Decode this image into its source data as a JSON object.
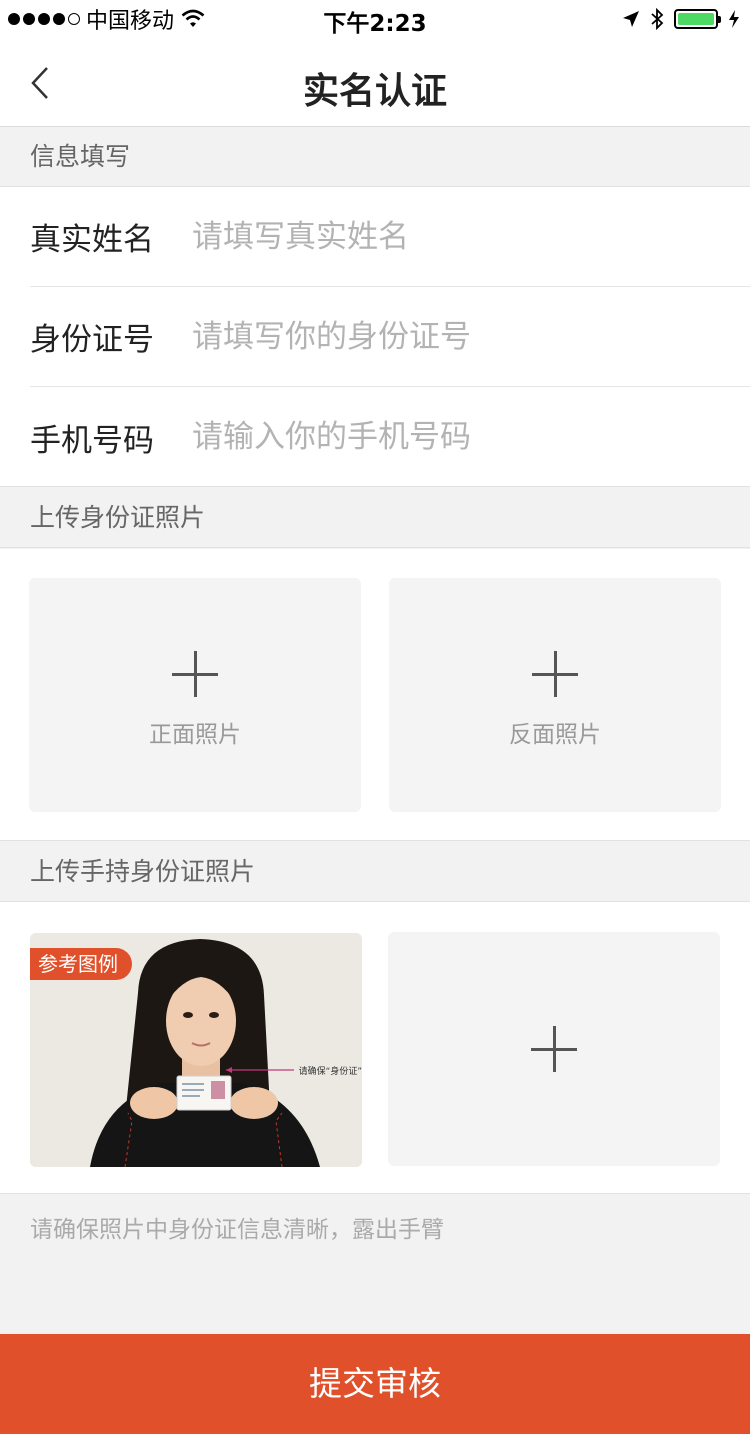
{
  "status_bar": {
    "carrier": "中国移动",
    "time": "下午2:23"
  },
  "nav": {
    "title": "实名认证"
  },
  "sections": {
    "info": "信息填写",
    "id_photo": "上传身份证照片",
    "hand_photo": "上传手持身份证照片"
  },
  "form": {
    "name_label": "真实姓名",
    "name_placeholder": "请填写真实姓名",
    "id_label": "身份证号",
    "id_placeholder": "请填写你的身份证号",
    "phone_label": "手机号码",
    "phone_placeholder": "请输入你的手机号码"
  },
  "uploads": {
    "front_label": "正面照片",
    "back_label": "反面照片"
  },
  "example": {
    "tag": "参考图例",
    "hint": "请确保“身份证”"
  },
  "note": "请确保照片中身份证信息清晰，露出手臂",
  "submit_label": "提交审核",
  "colors": {
    "accent": "#e0502a",
    "battery": "#4cd964",
    "page_bg": "#f2f2f2"
  }
}
